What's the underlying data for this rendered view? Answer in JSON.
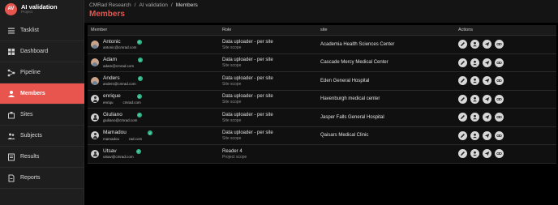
{
  "app": {
    "avatar_initials": "AV",
    "title": "AI validation",
    "subtitle": "Project"
  },
  "nav": [
    {
      "label": "Tasklist",
      "icon": "tasklist-icon"
    },
    {
      "label": "Dashboard",
      "icon": "dashboard-icon"
    },
    {
      "label": "Pipeline",
      "icon": "pipeline-icon"
    },
    {
      "label": "Members",
      "icon": "members-icon",
      "active": true
    },
    {
      "label": "Sites",
      "icon": "sites-icon"
    },
    {
      "label": "Subjects",
      "icon": "subjects-icon"
    },
    {
      "label": "Results",
      "icon": "results-icon"
    },
    {
      "label": "Reports",
      "icon": "reports-icon"
    }
  ],
  "breadcrumb": [
    "CMRad Research",
    "/",
    "AI validation",
    "/",
    "Members"
  ],
  "page_title": "Members",
  "table": {
    "headers": [
      "Member",
      "Role",
      "site",
      "Actions"
    ],
    "rows": [
      {
        "name": "Antonic",
        "email": "antonic@cmrad.com",
        "email2": "",
        "avatar": "photo",
        "role": "Data uploader - per site",
        "scope": "Site scope",
        "site": "Academia Health Sciences Center"
      },
      {
        "name": "Adam",
        "email": "adam@cmrad.com",
        "email2": "",
        "avatar": "photo",
        "role": "Data uploader - per site",
        "scope": "Site scope",
        "site": "Cascade Mercy Medical Center"
      },
      {
        "name": "Anders",
        "email": "anders@cmrad.com",
        "email2": "",
        "avatar": "photo",
        "role": "Data uploader - per site",
        "scope": "Site scope",
        "site": "Eden General Hospital"
      },
      {
        "name": "enrique",
        "email": "enriqu",
        "email2": "cmrad.com",
        "avatar": "generic",
        "role": "Data uploader - per site",
        "scope": "Site scope",
        "site": "Havenburgh medical center"
      },
      {
        "name": "Giuliano",
        "email": "giuliano@cmrad.com",
        "email2": "",
        "avatar": "generic",
        "role": "Data uploader - per site",
        "scope": "Site scope",
        "site": "Jasper Falls General Hospital"
      },
      {
        "name": "Mamadou",
        "email": "mamadou",
        "email2": "rad.com",
        "avatar": "generic",
        "role": "Data uploader - per site",
        "scope": "Site scope",
        "site": "Qaisars Medical Clinic"
      },
      {
        "name": "Utsav",
        "email": "utsav@cmrad.com",
        "email2": "",
        "avatar": "generic",
        "role": "Reader 4",
        "scope": "Project scope",
        "site": ""
      }
    ],
    "actions": [
      "edit-icon",
      "user-icon",
      "send-icon",
      "link-icon"
    ]
  },
  "colors": {
    "accent": "#e8554e",
    "verified": "#2fb58a"
  }
}
